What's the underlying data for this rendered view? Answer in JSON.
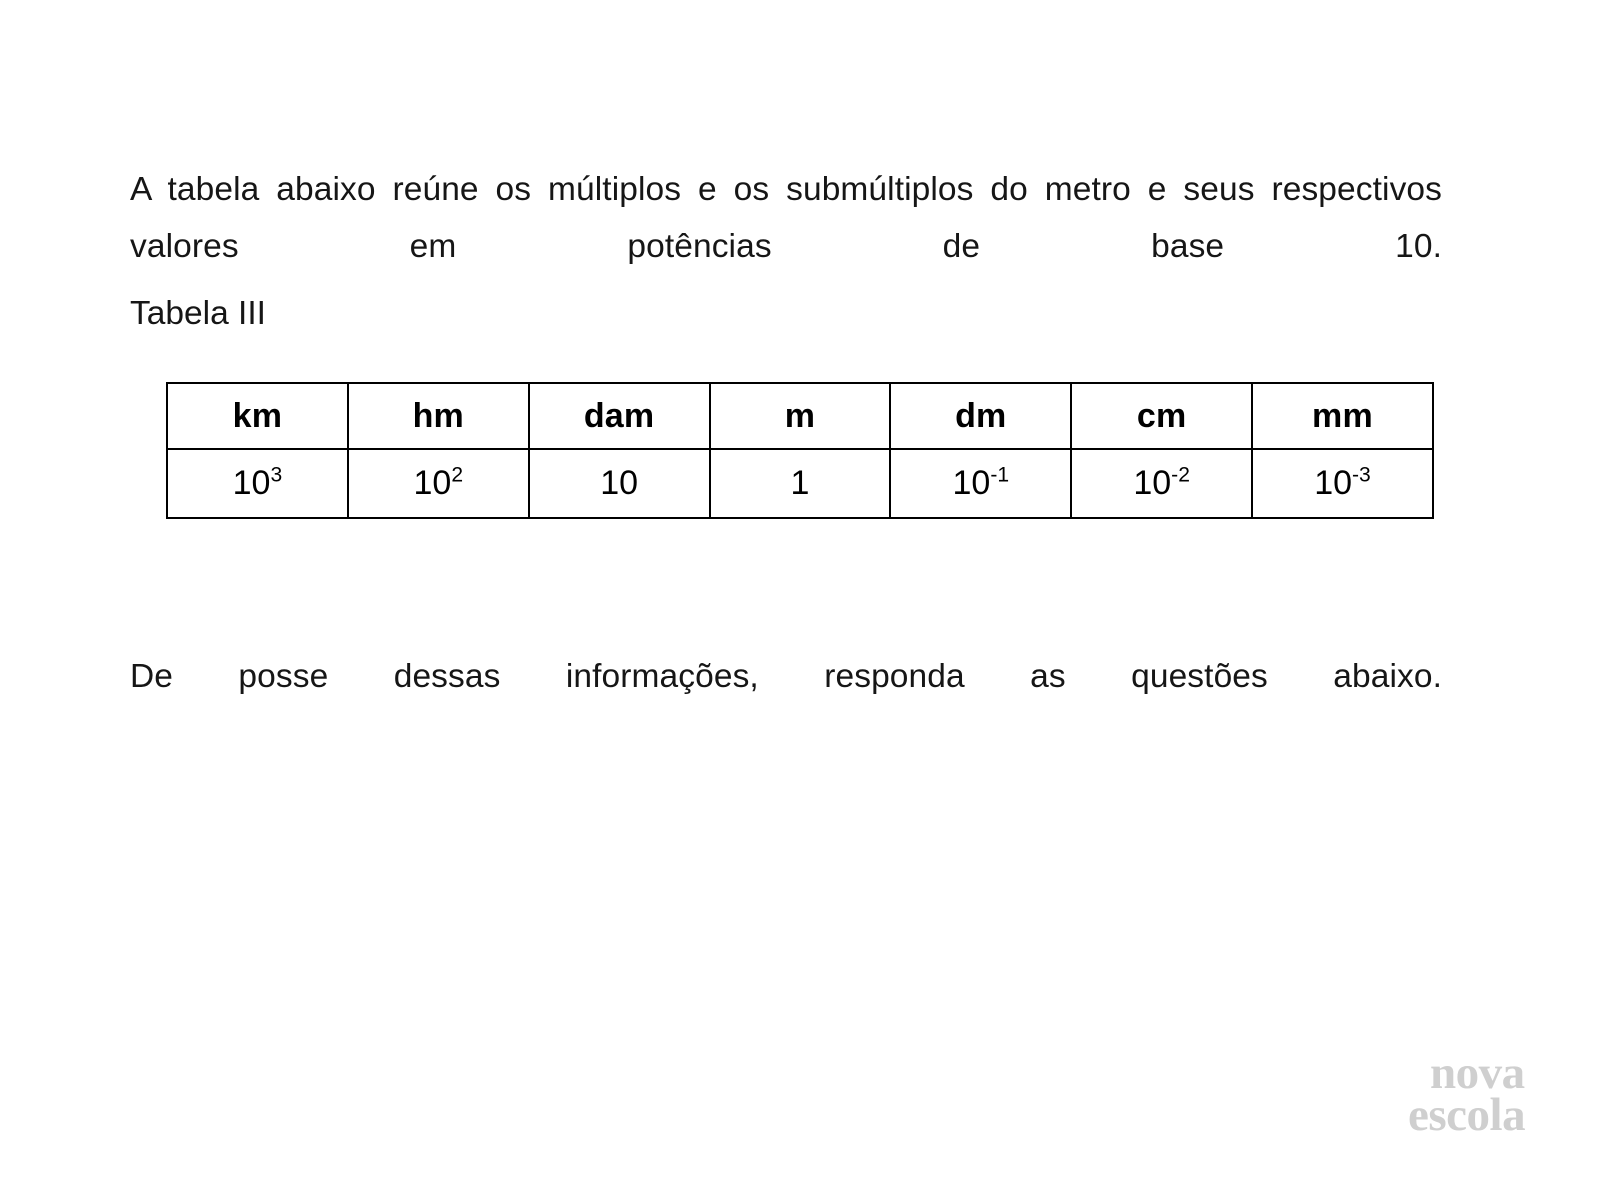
{
  "document": {
    "background_color": "#ffffff",
    "text_color": "#161616"
  },
  "intro_paragraph": "A tabela abaixo reúne os múltiplos e os submúltiplos do metro e seus respectivos valores em potências de base 10.",
  "table_label": "Tabela III",
  "closing_paragraph": "De posse dessas informações, responda as questões abaixo.",
  "table": {
    "border_color": "#000000",
    "headers": [
      "km",
      "hm",
      "dam",
      "m",
      "dm",
      "cm",
      "mm"
    ],
    "values": [
      {
        "base": "10",
        "exp": "3",
        "display": "10³"
      },
      {
        "base": "10",
        "exp": "2",
        "display": "10²"
      },
      {
        "base": "10",
        "exp": "",
        "display": "10"
      },
      {
        "base": "1",
        "exp": "",
        "display": "1"
      },
      {
        "base": "10",
        "exp": "-1",
        "display": "10⁻¹"
      },
      {
        "base": "10",
        "exp": "-2",
        "display": "10⁻²"
      },
      {
        "base": "10",
        "exp": "-3",
        "display": "10⁻³"
      }
    ]
  },
  "logo": {
    "line1": "nova",
    "line2": "escola",
    "color": "#cfcfcf"
  }
}
